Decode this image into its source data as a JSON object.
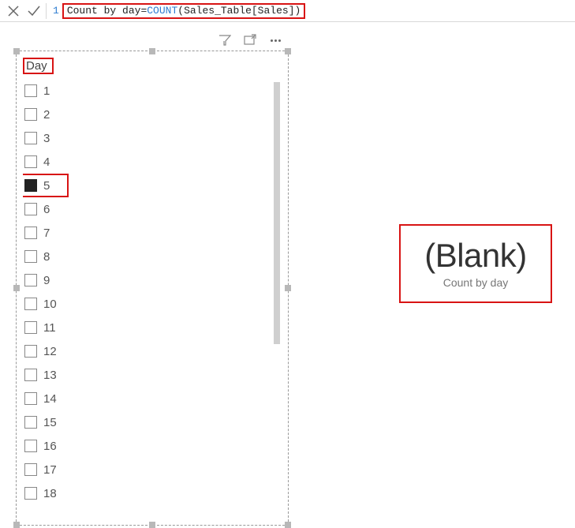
{
  "formula": {
    "line_number": "1",
    "measure_name": "Count by day",
    "equals": " = ",
    "func": "COUNT",
    "args": "(Sales_Table[Sales])"
  },
  "slicer": {
    "header": "Day",
    "items": [
      {
        "label": "1",
        "checked": false,
        "highlight": false
      },
      {
        "label": "2",
        "checked": false,
        "highlight": false
      },
      {
        "label": "3",
        "checked": false,
        "highlight": false
      },
      {
        "label": "4",
        "checked": false,
        "highlight": false
      },
      {
        "label": "5",
        "checked": true,
        "highlight": true
      },
      {
        "label": "6",
        "checked": false,
        "highlight": false
      },
      {
        "label": "7",
        "checked": false,
        "highlight": false
      },
      {
        "label": "8",
        "checked": false,
        "highlight": false
      },
      {
        "label": "9",
        "checked": false,
        "highlight": false
      },
      {
        "label": "10",
        "checked": false,
        "highlight": false
      },
      {
        "label": "11",
        "checked": false,
        "highlight": false
      },
      {
        "label": "12",
        "checked": false,
        "highlight": false
      },
      {
        "label": "13",
        "checked": false,
        "highlight": false
      },
      {
        "label": "14",
        "checked": false,
        "highlight": false
      },
      {
        "label": "15",
        "checked": false,
        "highlight": false
      },
      {
        "label": "16",
        "checked": false,
        "highlight": false
      },
      {
        "label": "17",
        "checked": false,
        "highlight": false
      },
      {
        "label": "18",
        "checked": false,
        "highlight": false
      }
    ]
  },
  "card": {
    "value": "(Blank)",
    "label": "Count by day"
  },
  "icons": {
    "filter": "filter-icon",
    "focus": "focus-mode-icon",
    "more": "more-options-icon"
  }
}
